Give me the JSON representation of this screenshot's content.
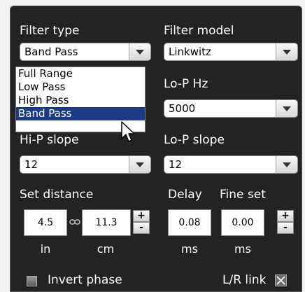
{
  "filter_type": {
    "label": "Filter type",
    "value": "Band Pass",
    "options": [
      "Full Range",
      "Low Pass",
      "High Pass",
      "Band Pass"
    ],
    "highlighted": "Band Pass"
  },
  "filter_model": {
    "label": "Filter model",
    "value": "Linkwitz"
  },
  "hip_slope": {
    "label": "Hi-P slope",
    "value": "12"
  },
  "lop_hz": {
    "label": "Lo-P Hz",
    "value": "5000"
  },
  "lop_slope": {
    "label": "Lo-P slope",
    "value": "12"
  },
  "distance": {
    "label": "Set distance",
    "in_value": "4.5",
    "cm_value": "11.3",
    "in_unit": "in",
    "cm_unit": "cm",
    "plus": "+",
    "minus": "-"
  },
  "delay": {
    "label": "Delay",
    "value": "0.08",
    "unit": "ms",
    "fine_label": "Fine set",
    "fine_value": "0.00",
    "fine_unit": "ms",
    "plus": "+",
    "minus": "-"
  },
  "invert_phase": {
    "label": "Invert phase",
    "checked": false
  },
  "lr_link": {
    "label": "L/R link",
    "checked": true
  },
  "colors": {
    "panel_bg": "#232323",
    "selection": "#1c3a86"
  }
}
